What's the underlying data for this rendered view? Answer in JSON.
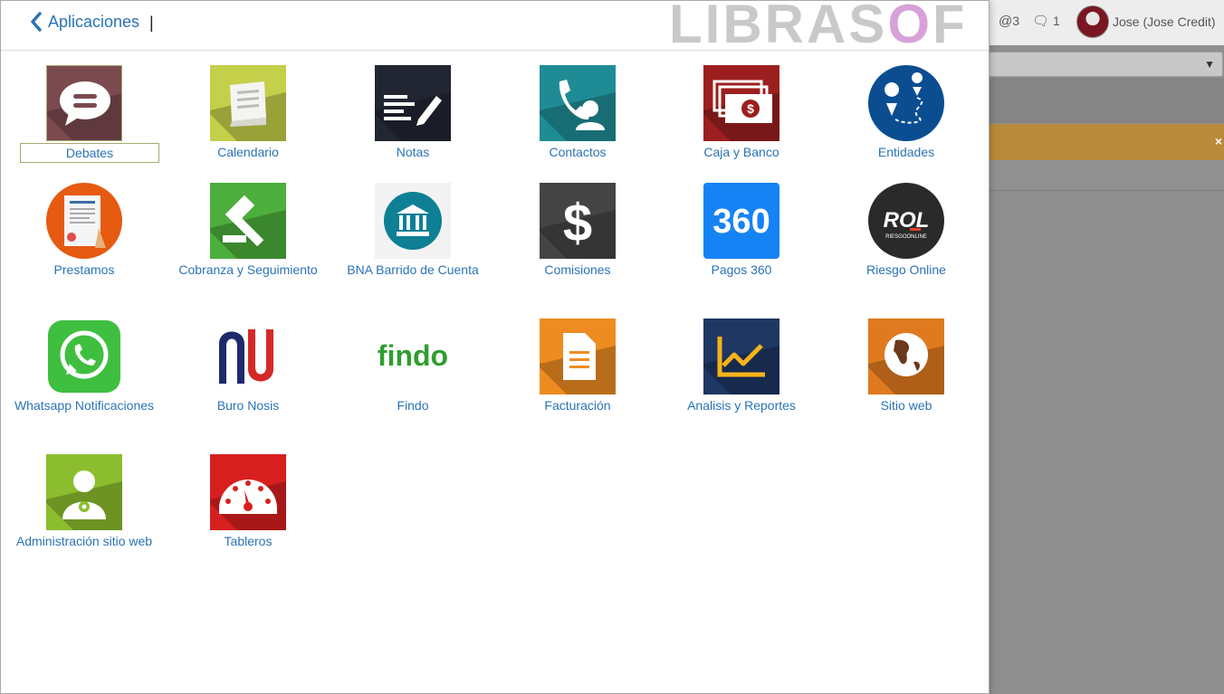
{
  "header": {
    "back_label": "Aplicaciones",
    "cursor": "|",
    "brand": {
      "pre": "LIBRAS",
      "o": "O",
      "post": "FT"
    }
  },
  "topbar": {
    "mentions": "3",
    "chats": "1",
    "user": "Jose (Jose Credit)"
  },
  "apps": [
    {
      "label": "Debates",
      "icon": "chat-bubble-icon",
      "color": "#7a4a4f"
    },
    {
      "label": "Calendario",
      "icon": "book-icon",
      "color": "#c4cf4a"
    },
    {
      "label": "Notas",
      "icon": "notes-pencil-icon",
      "color": "#222633"
    },
    {
      "label": "Contactos",
      "icon": "phone-contact-icon",
      "color": "#1f8c95"
    },
    {
      "label": "Caja y Banco",
      "icon": "money-stack-icon",
      "color": "#9c1f1f"
    },
    {
      "label": "Entidades",
      "icon": "map-route-icon",
      "color": "#0a4d91"
    },
    {
      "label": "Prestamos",
      "icon": "loan-document-icon",
      "color": "#e65a11"
    },
    {
      "label": "Cobranza y Seguimiento",
      "icon": "gavel-icon",
      "color": "#4cae3c"
    },
    {
      "label": "BNA Barrido de Cuenta",
      "icon": "bank-icon",
      "color": "#0e7f95"
    },
    {
      "label": "Comisiones",
      "icon": "dollar-icon",
      "color": "#444444"
    },
    {
      "label": "Pagos 360",
      "icon": "pagos-360-logo",
      "color": "#1683f5",
      "text": "360"
    },
    {
      "label": "Riesgo Online",
      "icon": "riesgo-online-logo",
      "color": "#2a2a2a",
      "text": "ROL",
      "sub": "RIESGOONLINE"
    },
    {
      "label": "Whatsapp Notificaciones",
      "icon": "whatsapp-icon",
      "color": "#3fbf3f"
    },
    {
      "label": "Buro Nosis",
      "icon": "nosis-logo-icon",
      "color": "#ffffff"
    },
    {
      "label": "Findo",
      "icon": "findo-logo",
      "color": "#2f9e2f",
      "text": "findo"
    },
    {
      "label": "Facturación",
      "icon": "invoice-icon",
      "color": "#ee8c22"
    },
    {
      "label": "Analisis y Reportes",
      "icon": "line-chart-icon",
      "color": "#1e3763"
    },
    {
      "label": "Sitio web",
      "icon": "globe-icon",
      "color": "#e07a1e"
    },
    {
      "label": "Administración sitio web",
      "icon": "user-gear-icon",
      "color": "#8cbd2e"
    },
    {
      "label": "Tableros",
      "icon": "dashboard-gauge-icon",
      "color": "#d81f1f"
    }
  ]
}
